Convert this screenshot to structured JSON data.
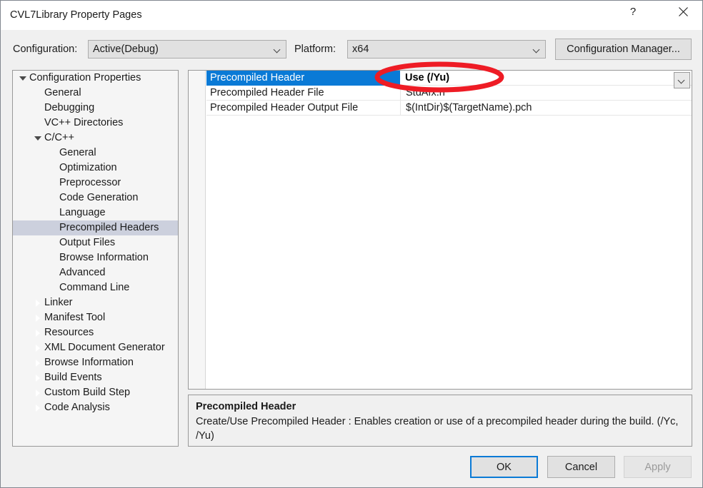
{
  "window": {
    "title": "CVL7Library Property Pages",
    "help_icon": "question-mark-icon",
    "close_icon": "close-x-icon"
  },
  "toolbar": {
    "configuration_label": "Configuration:",
    "configuration_value": "Active(Debug)",
    "platform_label": "Platform:",
    "platform_value": "x64",
    "configuration_manager_label": "Configuration Manager..."
  },
  "tree": {
    "items": [
      {
        "label": "Configuration Properties",
        "indent": 0,
        "glyph": "expanded",
        "selected": false
      },
      {
        "label": "General",
        "indent": 1,
        "glyph": "none",
        "selected": false
      },
      {
        "label": "Debugging",
        "indent": 1,
        "glyph": "none",
        "selected": false
      },
      {
        "label": "VC++ Directories",
        "indent": 1,
        "glyph": "none",
        "selected": false
      },
      {
        "label": "C/C++",
        "indent": 1,
        "glyph": "expanded",
        "selected": false
      },
      {
        "label": "General",
        "indent": 2,
        "glyph": "none",
        "selected": false
      },
      {
        "label": "Optimization",
        "indent": 2,
        "glyph": "none",
        "selected": false
      },
      {
        "label": "Preprocessor",
        "indent": 2,
        "glyph": "none",
        "selected": false
      },
      {
        "label": "Code Generation",
        "indent": 2,
        "glyph": "none",
        "selected": false
      },
      {
        "label": "Language",
        "indent": 2,
        "glyph": "none",
        "selected": false
      },
      {
        "label": "Precompiled Headers",
        "indent": 2,
        "glyph": "none",
        "selected": true
      },
      {
        "label": "Output Files",
        "indent": 2,
        "glyph": "none",
        "selected": false
      },
      {
        "label": "Browse Information",
        "indent": 2,
        "glyph": "none",
        "selected": false
      },
      {
        "label": "Advanced",
        "indent": 2,
        "glyph": "none",
        "selected": false
      },
      {
        "label": "Command Line",
        "indent": 2,
        "glyph": "none",
        "selected": false
      },
      {
        "label": "Linker",
        "indent": 1,
        "glyph": "collapsed",
        "selected": false
      },
      {
        "label": "Manifest Tool",
        "indent": 1,
        "glyph": "collapsed",
        "selected": false
      },
      {
        "label": "Resources",
        "indent": 1,
        "glyph": "collapsed",
        "selected": false
      },
      {
        "label": "XML Document Generator",
        "indent": 1,
        "glyph": "collapsed",
        "selected": false
      },
      {
        "label": "Browse Information",
        "indent": 1,
        "glyph": "collapsed",
        "selected": false
      },
      {
        "label": "Build Events",
        "indent": 1,
        "glyph": "collapsed",
        "selected": false
      },
      {
        "label": "Custom Build Step",
        "indent": 1,
        "glyph": "collapsed",
        "selected": false
      },
      {
        "label": "Code Analysis",
        "indent": 1,
        "glyph": "collapsed",
        "selected": false
      }
    ]
  },
  "grid": {
    "rows": [
      {
        "name": "Precompiled Header",
        "value": "Use (/Yu)",
        "selected": true,
        "has_dropdown": true
      },
      {
        "name": "Precompiled Header File",
        "value": "StdAfx.h",
        "selected": false,
        "has_dropdown": false
      },
      {
        "name": "Precompiled Header Output File",
        "value": "$(IntDir)$(TargetName).pch",
        "selected": false,
        "has_dropdown": false
      }
    ],
    "dropdown_icon": "chevron-down-icon"
  },
  "description": {
    "title": "Precompiled Header",
    "body": "Create/Use Precompiled Header : Enables creation or use of a precompiled header during the build. (/Yc, /Yu)"
  },
  "buttons": {
    "ok": "OK",
    "cancel": "Cancel",
    "apply": "Apply"
  },
  "annotation": {
    "shape": "red-ellipse-highlight",
    "color": "#ee1c25",
    "targets": "Use (/Yu)"
  },
  "colors": {
    "selection_blue": "#0a7ad6",
    "tree_selection": "#ccd0dd",
    "dialog_bg": "#f0f0f0",
    "annotation_red": "#ee1c25"
  }
}
